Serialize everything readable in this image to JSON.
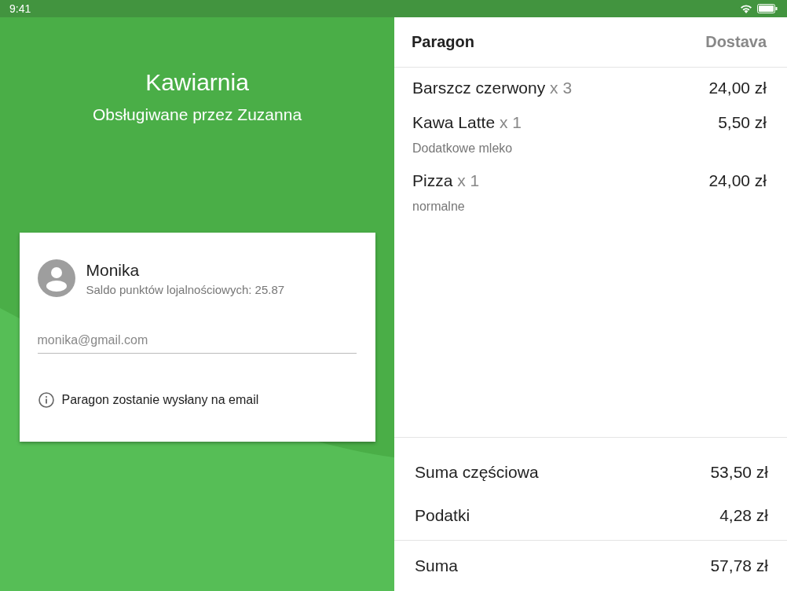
{
  "status_bar": {
    "time": "9:41"
  },
  "store": {
    "title": "Kawiarnia",
    "subtitle": "Obsługiwane przez Zuzanna"
  },
  "customer": {
    "name": "Monika",
    "loyalty": "Saldo punktów lojalnościowych: 25.87",
    "email": {
      "placeholder": "monika@gmail.com"
    },
    "notice": "Paragon zostanie wysłany na email"
  },
  "tabs": [
    {
      "label": "Paragon",
      "selected": true
    },
    {
      "label": "Dostava",
      "selected": false
    }
  ],
  "items": [
    {
      "name": "Barszcz czerwony",
      "qty": "x 3",
      "price": "24,00 zł"
    },
    {
      "name": "Kawa Latte",
      "qty": "x 1",
      "price": "5,50 zł",
      "note": "Dodatkowe mleko"
    },
    {
      "name": "Pizza",
      "qty": "x 1",
      "price": "24,00 zł",
      "note": "normalne"
    }
  ],
  "subtotals": [
    {
      "label": "Suma częściowa",
      "value": "53,50 zł"
    },
    {
      "label": "Podatki",
      "value": "4,28 zł"
    }
  ],
  "total": {
    "label": "Suma",
    "value": "57,78 zł"
  }
}
